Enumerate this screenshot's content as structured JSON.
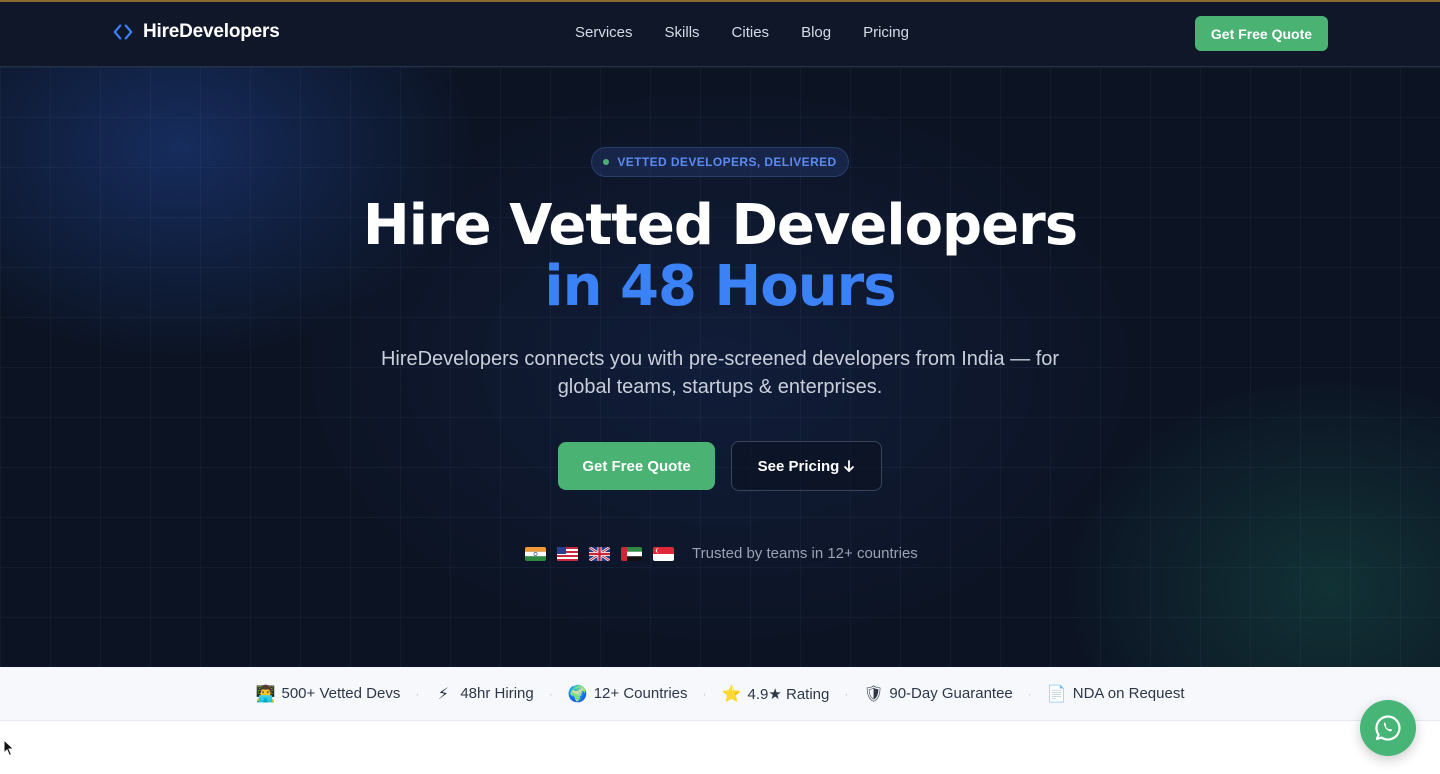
{
  "brand": {
    "name": "HireDevelopers",
    "icon": "code-brackets-icon",
    "accent": "#3b82f6"
  },
  "nav": {
    "links": [
      {
        "label": "Services"
      },
      {
        "label": "Skills"
      },
      {
        "label": "Cities"
      },
      {
        "label": "Blog"
      },
      {
        "label": "Pricing"
      }
    ],
    "cta_label": "Get Free Quote"
  },
  "hero": {
    "badge": "VETTED DEVELOPERS, DELIVERED",
    "headline_line1": "Hire Vetted Developers",
    "headline_line2": "in 48 Hours",
    "subtitle": "HireDevelopers connects you with pre-screened developers from India — for global teams, startups & enterprises.",
    "primary_cta": "Get Free Quote",
    "secondary_cta": "See Pricing",
    "secondary_cta_icon": "arrow-down-icon",
    "trust_text": "Trusted by teams in 12+ countries",
    "flags": [
      "india-flag-icon",
      "usa-flag-icon",
      "uk-flag-icon",
      "uae-flag-icon",
      "singapore-flag-icon"
    ]
  },
  "stats": [
    {
      "emoji": "👨‍💻",
      "icon": "developer-icon",
      "label": "500+ Vetted Devs"
    },
    {
      "emoji": "⚡",
      "icon": "lightning-icon",
      "label": "48hr Hiring"
    },
    {
      "emoji": "🌍",
      "icon": "globe-icon",
      "label": "12+ Countries"
    },
    {
      "emoji": "⭐",
      "icon": "star-icon",
      "label": "4.9★ Rating"
    },
    {
      "emoji": "🛡",
      "icon": "shield-icon",
      "label": "90-Day Guarantee"
    },
    {
      "emoji": "📄",
      "icon": "document-icon",
      "label": "NDA on Request"
    }
  ],
  "colors": {
    "cta_green": "#4ab273",
    "nav_bg": "#0f1729",
    "hero_bg": "#0c1424",
    "headline_blue": "#3b82f6"
  },
  "floating": {
    "icon": "whatsapp-icon"
  }
}
